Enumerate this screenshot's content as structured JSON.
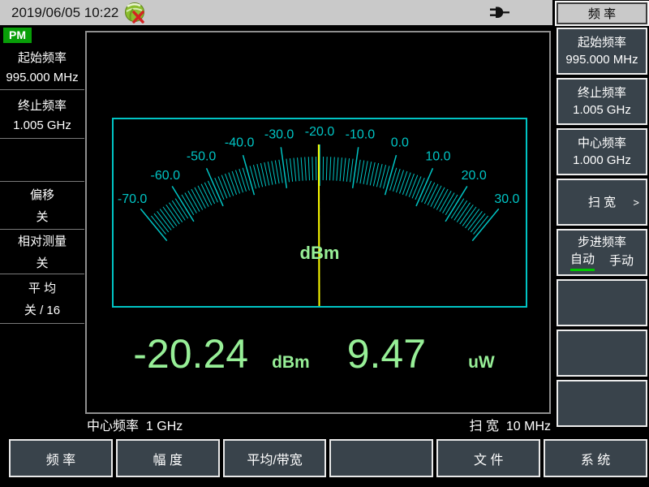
{
  "colors": {
    "accent_cyan": "#00c4c4",
    "needle_yellow": "#ffff00",
    "value_green": "#97ef97",
    "selected_underline_green": "#00c800",
    "button_bg": "#39434b",
    "topbar_bg": "#c9c9c9",
    "badge_green": "#089e08"
  },
  "top_bar": {
    "datetime": "2019/06/05 10:22",
    "gps_icon": "gps-disconnected-icon",
    "power_icon": "power-plug-icon"
  },
  "left_panel": {
    "mode_badge": "PM",
    "items": [
      {
        "label": "起始频率",
        "value": "995.000 MHz"
      },
      {
        "label": "终止频率",
        "value": "1.005 GHz"
      },
      {
        "label": "",
        "value": ""
      },
      {
        "label": "偏移",
        "value": "关"
      },
      {
        "label": "相对测量",
        "value": "关"
      },
      {
        "label": "平 均",
        "value": "关 / 16"
      }
    ]
  },
  "right_panel": {
    "header": "频 率",
    "buttons": [
      {
        "label": "起始频率",
        "value": "995.000 MHz"
      },
      {
        "label": "终止频率",
        "value": "1.005 GHz"
      },
      {
        "label": "中心频率",
        "value": "1.000 GHz"
      },
      {
        "label": "扫 宽",
        "arrow": ">"
      },
      {
        "label": "步进频率",
        "options": [
          "自动",
          "手动"
        ],
        "selected": "自动"
      },
      {
        "label": ""
      },
      {
        "label": ""
      },
      {
        "label": ""
      }
    ]
  },
  "status_bar": {
    "left_label": "中心频率",
    "left_value": "1 GHz",
    "right_label": "扫 宽",
    "right_value": "10 MHz"
  },
  "bottom_bar": {
    "buttons": [
      "频 率",
      "幅 度",
      "平均/带宽",
      "",
      "文 件",
      "系 统"
    ]
  },
  "chart_data": {
    "type": "gauge",
    "min": -70,
    "max": 30,
    "major_ticks": [
      -70,
      -60,
      -50,
      -40,
      -30,
      -20,
      -10,
      0,
      10,
      20,
      30
    ],
    "minor_tick_step": 1,
    "arc_span_deg": 79,
    "unit": "dBm",
    "needle_value": -20.24,
    "readouts": [
      {
        "value": "-20.24",
        "unit": "dBm"
      },
      {
        "value": "9.47",
        "unit": "uW"
      }
    ]
  }
}
